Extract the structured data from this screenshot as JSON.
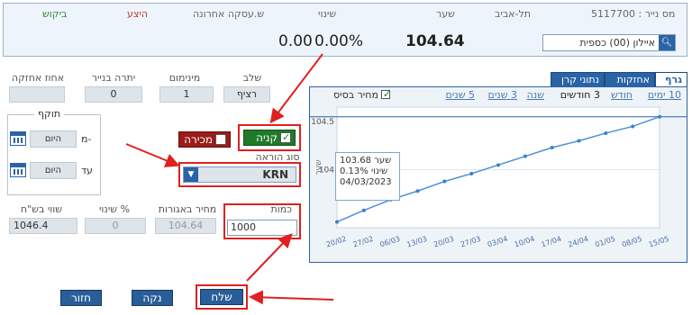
{
  "header": {
    "security_label": "מס נייר : 5117700",
    "exchange": "תל-אביב",
    "security_name": "איילון (00) כספית",
    "price_label": "שער",
    "price": "104.64",
    "change_label": "שינוי",
    "change_value": "0.00",
    "change_pct": "0.00%",
    "last_trade_label": "ש.עסקה אחרונה",
    "offer_label": "היצע",
    "demand_label": "ביקוש"
  },
  "info": {
    "stage_label": "שלב",
    "stage_value": "רציף",
    "minimum_label": "מינימום",
    "minimum_value": "1",
    "balance_label": "יתרה בנייר",
    "balance_value": "0",
    "holding_pct_label": "אחוז אחזקה",
    "holding_pct_value": ""
  },
  "validity": {
    "title": "תוקף",
    "from_label": "מ-",
    "from_value": "היום",
    "to_label": "עד",
    "to_value": "היום"
  },
  "order": {
    "buy_label": "קניה",
    "sell_label": "מכירה",
    "order_type_label": "סוג הוראה",
    "order_type_value": "KRN",
    "quantity_label": "כמות",
    "quantity_value": "1000",
    "agorot_price_label": "מחיר באגורות",
    "agorot_price_value": "104.64",
    "change_pct_label": "% שינוי",
    "change_pct_value": "0",
    "value_nis_label": "שווי בש\"ח",
    "value_nis_value": "1046.4"
  },
  "buttons": {
    "send": "שלח",
    "clear": "נקה",
    "back": "חזור"
  },
  "chart_panel": {
    "tabs": [
      "גרף",
      "אחזקות",
      "נתוני קרן"
    ],
    "active_tab": "גרף",
    "ranges": [
      "10 ימים",
      "חודש",
      "3 חודשים",
      "שנה",
      "3 שנים",
      "5 שנים"
    ],
    "active_range": "3 חודשים",
    "base_price_label": "מחיר בסיס",
    "tooltip": {
      "price_label": "שער",
      "price": "103.68",
      "change_label": "שינוי",
      "change": "0.13%",
      "date": "04/03/2023"
    },
    "y_axis_title": "שער",
    "colors": {
      "line": "#4a90d9",
      "marker": "#3a7fc9",
      "band": "#2a63a6"
    }
  },
  "chart_data": {
    "type": "line",
    "x": [
      "20/02",
      "27/02",
      "06/03",
      "13/03",
      "20/03",
      "27/03",
      "03/04",
      "10/04",
      "17/04",
      "24/04",
      "01/05",
      "08/05",
      "15/05"
    ],
    "series": [
      {
        "values": [
          103.46,
          103.58,
          103.69,
          103.78,
          103.88,
          103.96,
          104.05,
          104.14,
          104.23,
          104.3,
          104.38,
          104.45,
          104.55
        ]
      }
    ],
    "yticks": [
      104,
      104.5
    ],
    "ylim": [
      103.4,
      104.65
    ]
  }
}
